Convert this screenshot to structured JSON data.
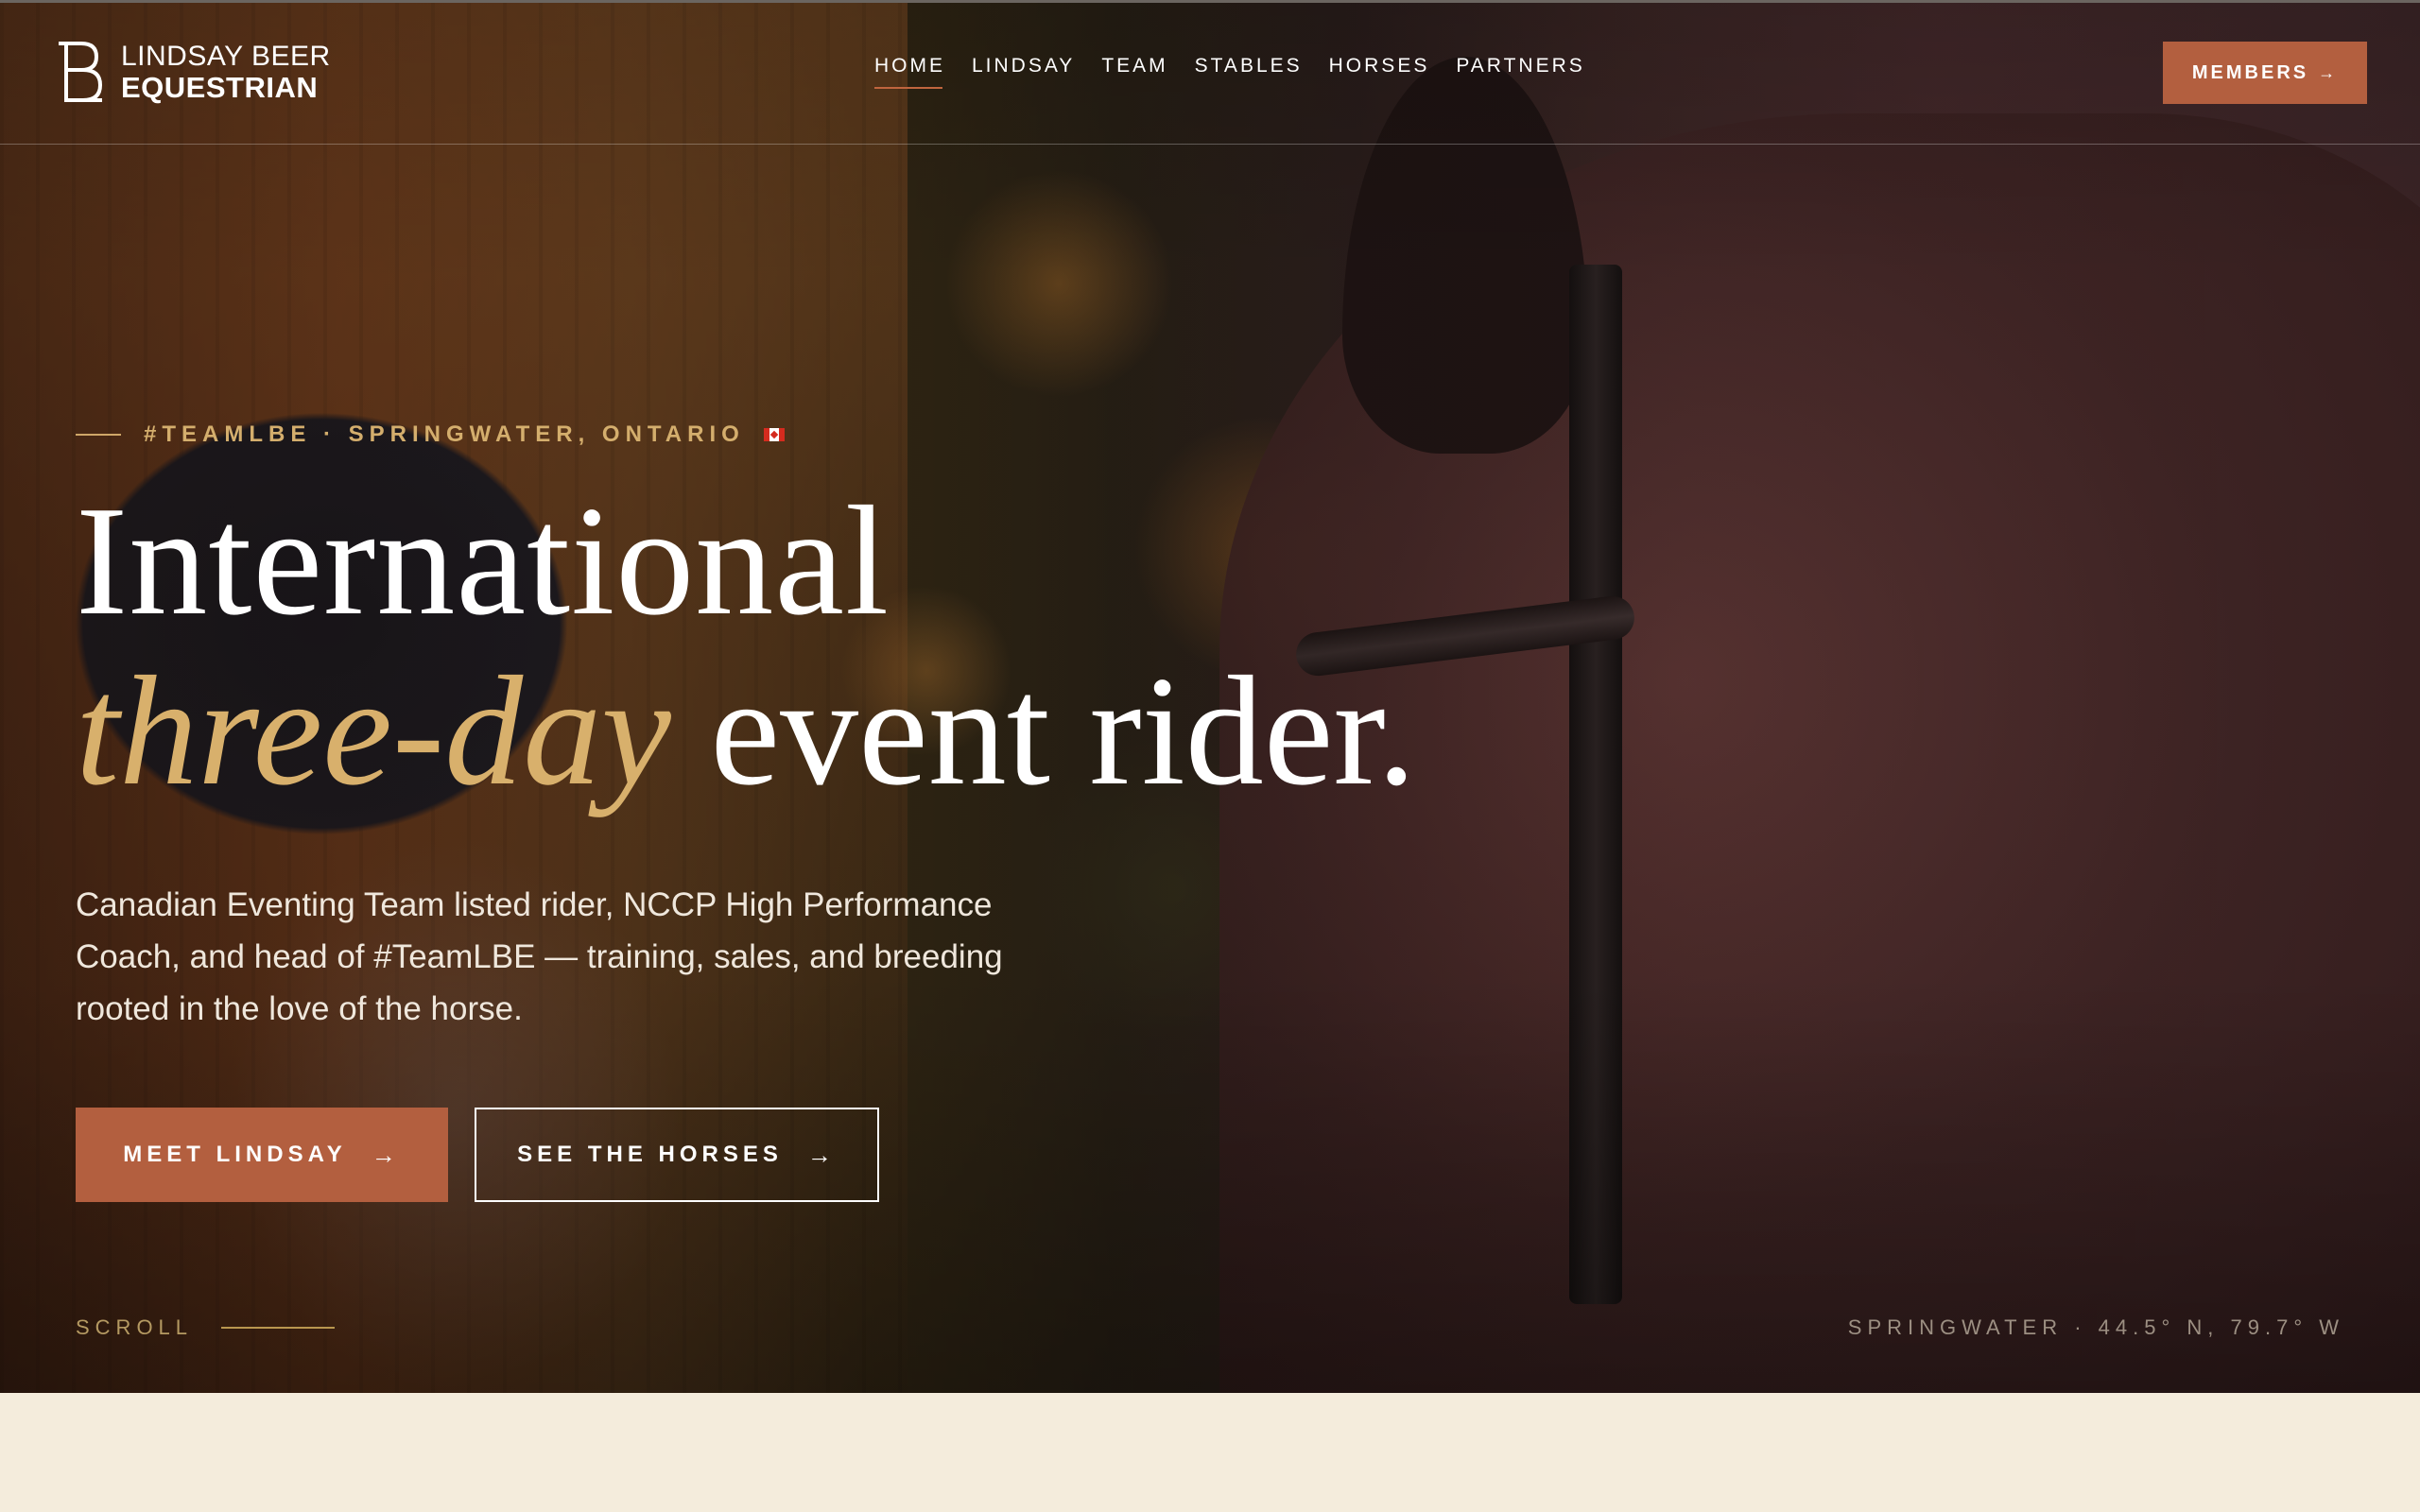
{
  "brand": {
    "line1": "LINDSAY BEER",
    "line2": "EQUESTRIAN",
    "monogram": "LB"
  },
  "nav": {
    "items": [
      {
        "label": "HOME",
        "active": true
      },
      {
        "label": "LINDSAY"
      },
      {
        "label": "TEAM"
      },
      {
        "label": "STABLES"
      },
      {
        "label": "HORSES"
      },
      {
        "label": "PARTNERS"
      }
    ],
    "members_label": "MEMBERS",
    "members_icon": "arrow-right-icon"
  },
  "hero": {
    "eyebrow": "#TEAMLBE · SPRINGWATER, ONTARIO",
    "eyebrow_flag": "canada-flag-icon",
    "headline_line1": "International",
    "headline_italic": "three-day",
    "headline_rest": " event rider.",
    "lede": "Canadian Eventing Team listed rider, NCCP High Performance Coach, and head of #TeamLBE — training, sales, and breeding rooted in the love of the horse.",
    "cta_primary": "MEET LINDSAY",
    "cta_secondary": "SEE THE HORSES",
    "arrow_glyph": "→",
    "scroll_label": "SCROLL",
    "coordinates": "SPRINGWATER · 44.5° N, 79.7° W"
  },
  "colors": {
    "accent": "#b35f3f",
    "gold": "#d8b06c",
    "cream": "#f4ecdc"
  }
}
